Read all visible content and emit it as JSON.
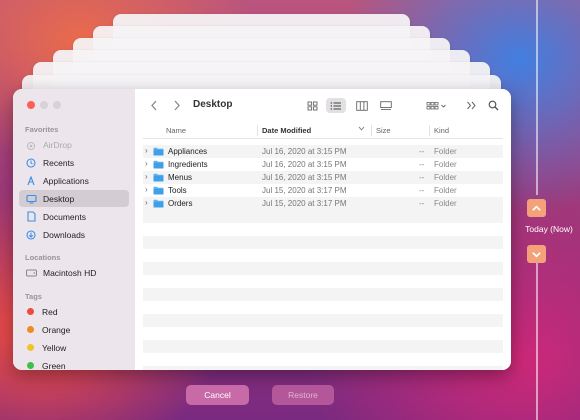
{
  "timeline": {
    "label": "Today (Now)"
  },
  "window": {
    "title": "Desktop",
    "colors": {
      "accent": "#3a8ee6",
      "close": "#fd5f57",
      "selection": "#d3ccd3"
    }
  },
  "sidebar": {
    "favorites_header": "Favorites",
    "favorites": [
      {
        "label": "AirDrop",
        "icon": "airdrop-icon"
      },
      {
        "label": "Recents",
        "icon": "clock-icon"
      },
      {
        "label": "Applications",
        "icon": "applications-icon"
      },
      {
        "label": "Desktop",
        "icon": "desktop-icon"
      },
      {
        "label": "Documents",
        "icon": "document-icon"
      },
      {
        "label": "Downloads",
        "icon": "download-icon"
      }
    ],
    "locations_header": "Locations",
    "locations": [
      {
        "label": "Macintosh HD",
        "icon": "harddrive-icon"
      }
    ],
    "tags_header": "Tags",
    "tags": [
      {
        "label": "Red",
        "color": "#f0493e"
      },
      {
        "label": "Orange",
        "color": "#f08a24"
      },
      {
        "label": "Yellow",
        "color": "#f0c424"
      },
      {
        "label": "Green",
        "color": "#3fbf4a"
      }
    ]
  },
  "columns": {
    "name": "Name",
    "date": "Date Modified",
    "size": "Size",
    "kind": "Kind"
  },
  "files": [
    {
      "name": "Appliances",
      "date": "Jul 16, 2020 at 3:15 PM",
      "size": "--",
      "kind": "Folder"
    },
    {
      "name": "Ingredients",
      "date": "Jul 16, 2020 at 3:15 PM",
      "size": "--",
      "kind": "Folder"
    },
    {
      "name": "Menus",
      "date": "Jul 16, 2020 at 3:15 PM",
      "size": "--",
      "kind": "Folder"
    },
    {
      "name": "Tools",
      "date": "Jul 15, 2020 at 3:17 PM",
      "size": "--",
      "kind": "Folder"
    },
    {
      "name": "Orders",
      "date": "Jul 15, 2020 at 3:17 PM",
      "size": "--",
      "kind": "Folder"
    }
  ],
  "buttons": {
    "cancel": "Cancel",
    "restore": "Restore"
  }
}
